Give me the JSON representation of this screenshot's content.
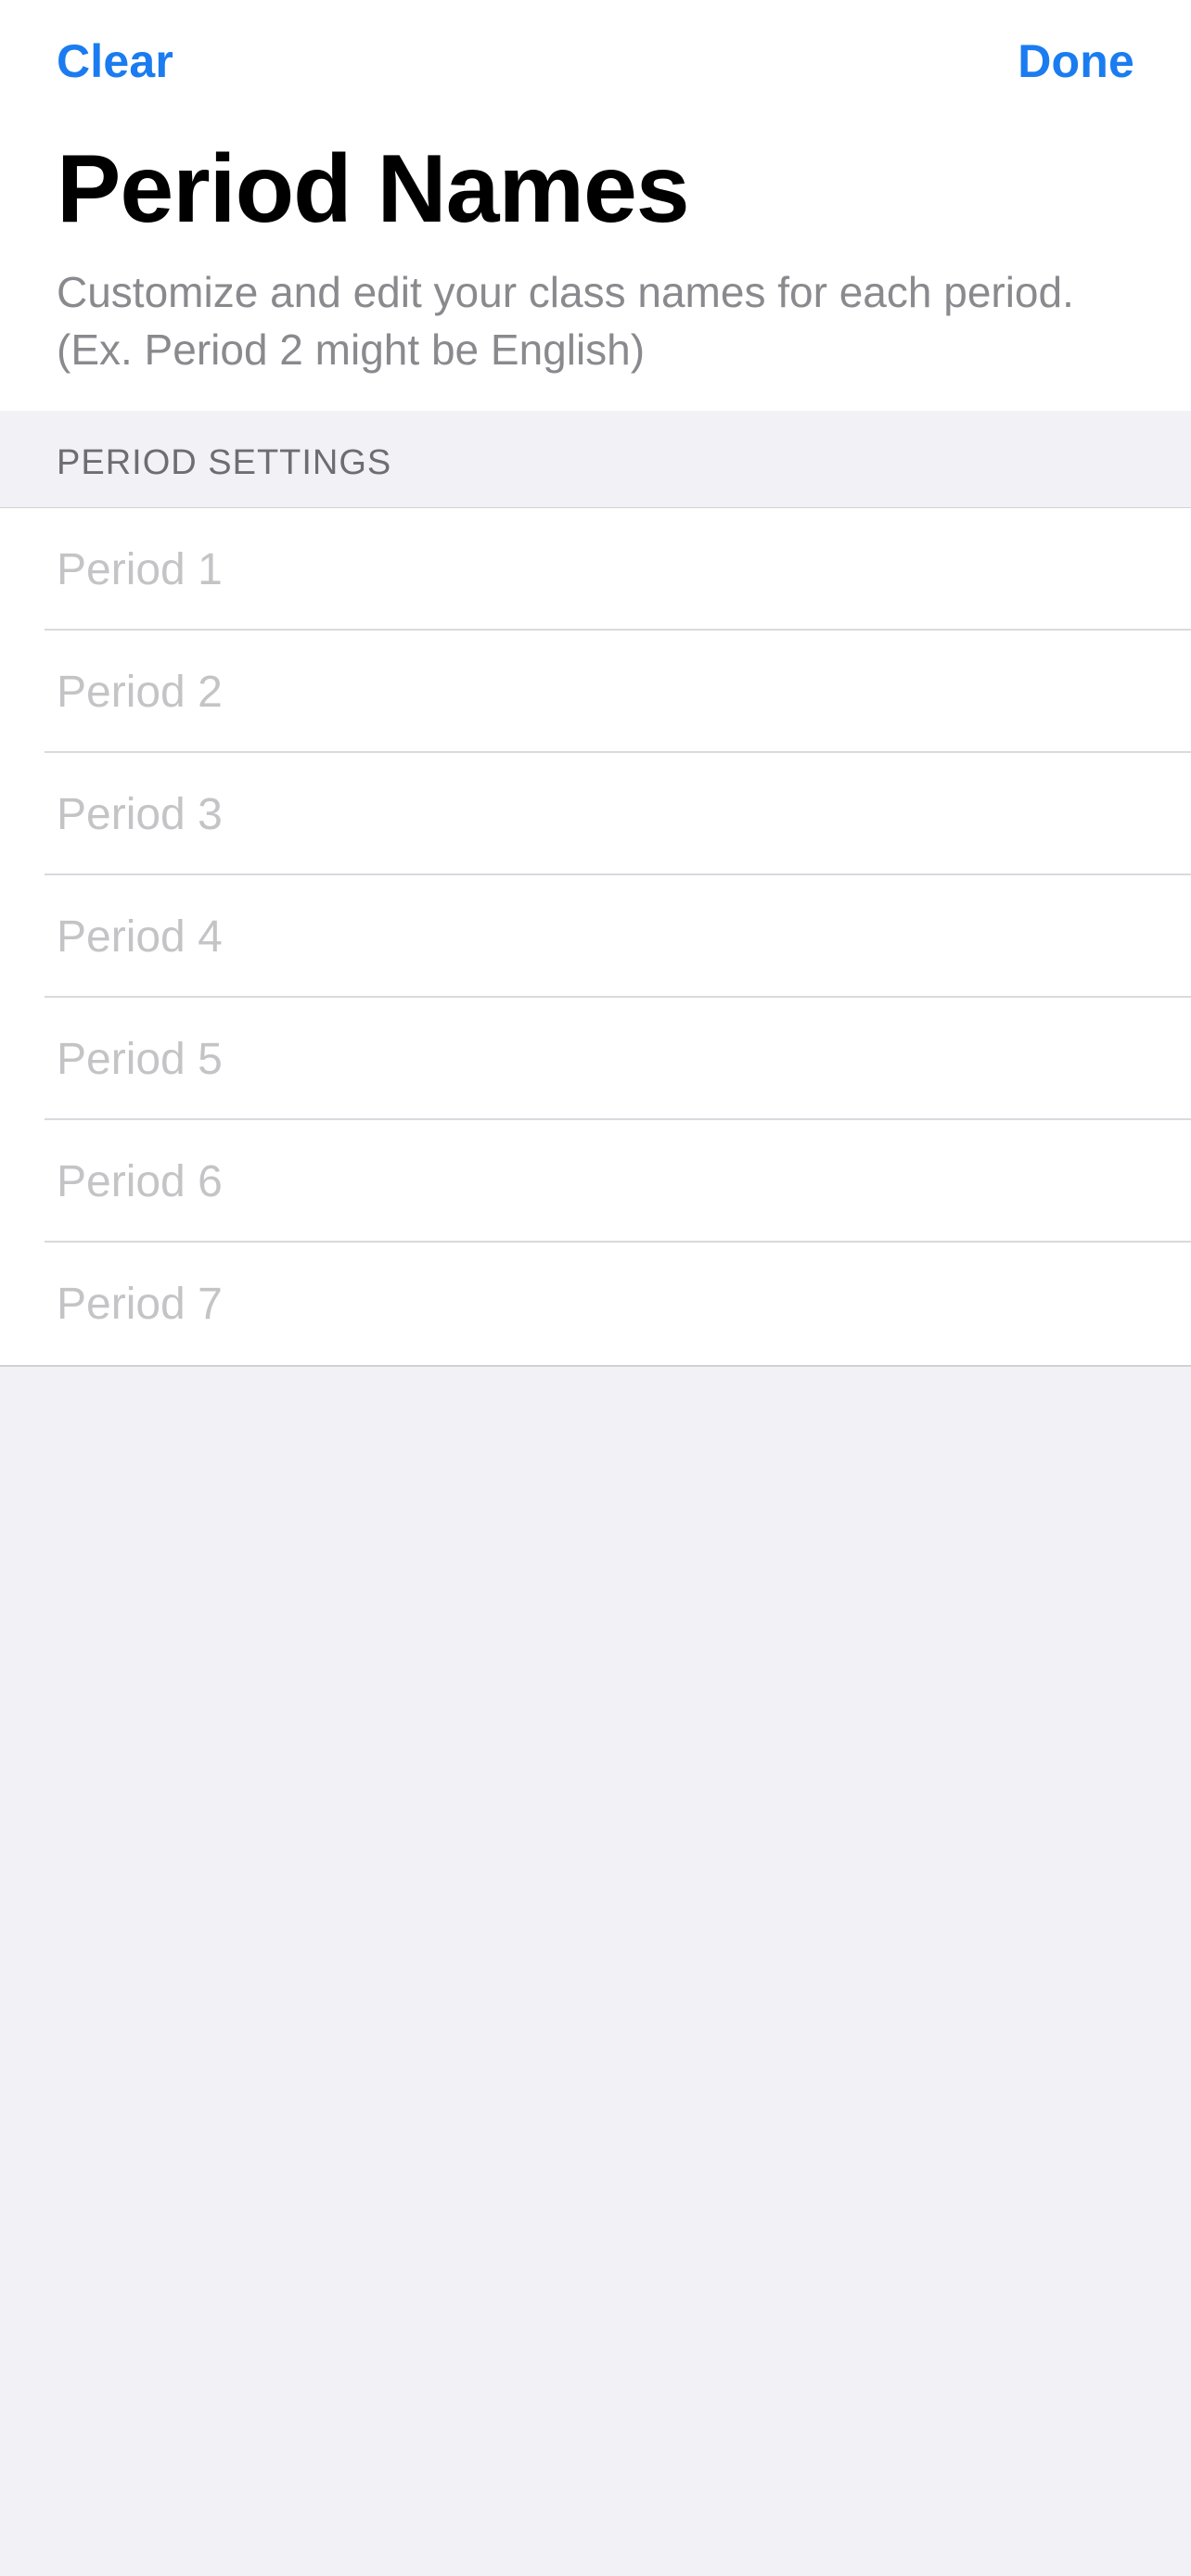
{
  "nav": {
    "clear_label": "Clear",
    "done_label": "Done"
  },
  "header": {
    "title": "Period Names",
    "subtitle": "Customize and edit your class names for each period. (Ex. Period 2 might be English)"
  },
  "section": {
    "label": "PERIOD SETTINGS"
  },
  "periods": [
    {
      "value": "",
      "placeholder": "Period 1"
    },
    {
      "value": "",
      "placeholder": "Period 2"
    },
    {
      "value": "",
      "placeholder": "Period 3"
    },
    {
      "value": "",
      "placeholder": "Period 4"
    },
    {
      "value": "",
      "placeholder": "Period 5"
    },
    {
      "value": "",
      "placeholder": "Period 6"
    },
    {
      "value": "",
      "placeholder": "Period 7"
    }
  ],
  "colors": {
    "accent": "#1a7cf0",
    "background": "#f1f1f6",
    "placeholder": "#c4c4c7",
    "subtitle": "#8a8a8e"
  }
}
